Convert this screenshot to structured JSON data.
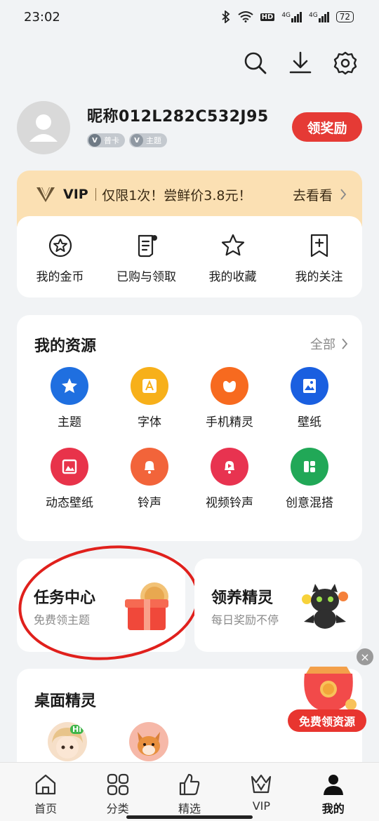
{
  "status_bar": {
    "time": "23:02",
    "signal_1": "4G",
    "signal_2": "4G",
    "hd": "HD",
    "battery": "72"
  },
  "profile": {
    "nickname": "昵称012L282C532J95",
    "badge_card": "普卡",
    "badge_theme": "主题",
    "reward_label": "领奖励"
  },
  "vip_banner": {
    "tag": "VIP",
    "text": "仅限1次！尝鲜价3.8元！",
    "go_label": "去看看"
  },
  "quick_actions": [
    {
      "label": "我的金币",
      "icon": "coin-star-icon"
    },
    {
      "label": "已购与领取",
      "icon": "receipt-icon"
    },
    {
      "label": "我的收藏",
      "icon": "star-icon"
    },
    {
      "label": "我的关注",
      "icon": "bookmark-plus-icon"
    }
  ],
  "resources": {
    "title": "我的资源",
    "all_label": "全部",
    "items": [
      {
        "label": "主题",
        "icon": "theme-icon",
        "color": "#1f6fe0"
      },
      {
        "label": "字体",
        "icon": "font-icon",
        "color": "#f7b01a"
      },
      {
        "label": "手机精灵",
        "icon": "sprite-icon",
        "color": "#f76a1f"
      },
      {
        "label": "壁纸",
        "icon": "wallpaper-icon",
        "color": "#1a5fe0"
      },
      {
        "label": "动态壁纸",
        "icon": "live-wallpaper-icon",
        "color": "#e8334a"
      },
      {
        "label": "铃声",
        "icon": "bell-icon",
        "color": "#f2643a"
      },
      {
        "label": "视频铃声",
        "icon": "video-ringtone-icon",
        "color": "#e83350"
      },
      {
        "label": "创意混搭",
        "icon": "mix-icon",
        "color": "#21a857"
      }
    ]
  },
  "task_center": {
    "title": "任务中心",
    "subtitle": "免费领主题"
  },
  "sprite_promo": {
    "title": "领养精灵",
    "subtitle": "每日奖励不停"
  },
  "desktop_sprite": {
    "title": "桌面精灵",
    "hi_badge": "Hi"
  },
  "float_promo": {
    "label": "免费领资源",
    "close": "×"
  },
  "bottom_nav": [
    {
      "label": "首页",
      "icon": "home-icon"
    },
    {
      "label": "分类",
      "icon": "grid-icon"
    },
    {
      "label": "精选",
      "icon": "thumb-icon"
    },
    {
      "label": "VIP",
      "icon": "vip-crown-icon"
    },
    {
      "label": "我的",
      "icon": "person-icon",
      "active": true
    }
  ]
}
